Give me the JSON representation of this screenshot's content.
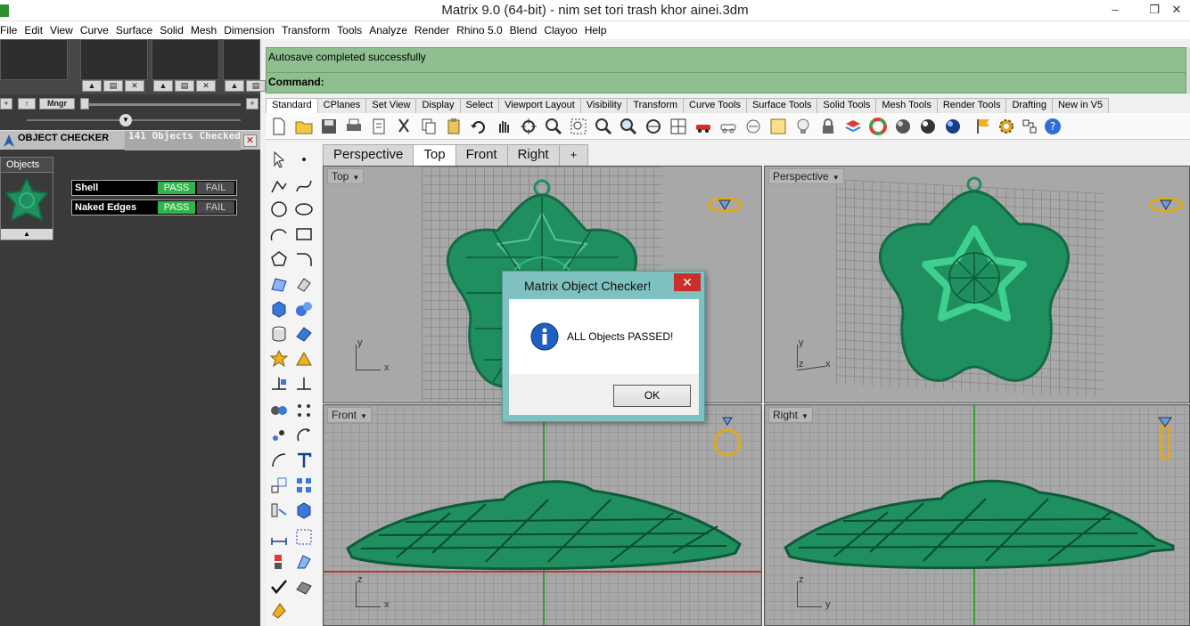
{
  "window": {
    "title": "Matrix 9.0 (64-bit) - nim set tori trash khor ainei.3dm",
    "minimize": "–",
    "maximize": "❐",
    "close": "✕"
  },
  "menu": [
    "File",
    "Edit",
    "View",
    "Curve",
    "Surface",
    "Solid",
    "Mesh",
    "Dimension",
    "Transform",
    "Tools",
    "Analyze",
    "Render",
    "Rhino 5.0",
    "Blend",
    "Clayoo",
    "Help"
  ],
  "left_panel": {
    "mngr_label": "Mngr",
    "checker_title": "OBJECT CHECKER",
    "checker_count": "141  Objects Checked",
    "checker_close": "✕",
    "objects_label": "Objects",
    "checks": [
      {
        "label": "Shell",
        "pass": "PASS",
        "fail": "FAIL"
      },
      {
        "label": "Naked Edges",
        "pass": "PASS",
        "fail": "FAIL"
      }
    ]
  },
  "command": {
    "message": "Autosave completed successfully",
    "prompt": "Command:"
  },
  "toolbar_tabs": [
    "Standard",
    "CPlanes",
    "Set View",
    "Display",
    "Select",
    "Viewport Layout",
    "Visibility",
    "Transform",
    "Curve Tools",
    "Surface Tools",
    "Solid Tools",
    "Mesh Tools",
    "Render Tools",
    "Drafting",
    "New in V5"
  ],
  "viewport_tabs": [
    "Perspective",
    "Top",
    "Front",
    "Right",
    "+"
  ],
  "active_viewport_tab": "Top",
  "viewports": {
    "top": {
      "label": "Top",
      "axis_x": "x",
      "axis_y": "y"
    },
    "perspective": {
      "label": "Perspective",
      "axis_x": "x",
      "axis_y": "y",
      "axis_z": "z"
    },
    "front": {
      "label": "Front",
      "axis_x": "x",
      "axis_z": "z"
    },
    "right": {
      "label": "Right",
      "axis_y": "y",
      "axis_z": "z"
    }
  },
  "dialog": {
    "title": "Matrix Object Checker!",
    "message": "ALL Objects PASSED!",
    "ok": "OK",
    "close": "✕"
  },
  "colors": {
    "model_green": "#1f8f5f",
    "command_bg": "#8fbf8f",
    "pass_green": "#2fb54a",
    "dialog_frame": "#7fc0c0",
    "close_red": "#c9302c"
  }
}
